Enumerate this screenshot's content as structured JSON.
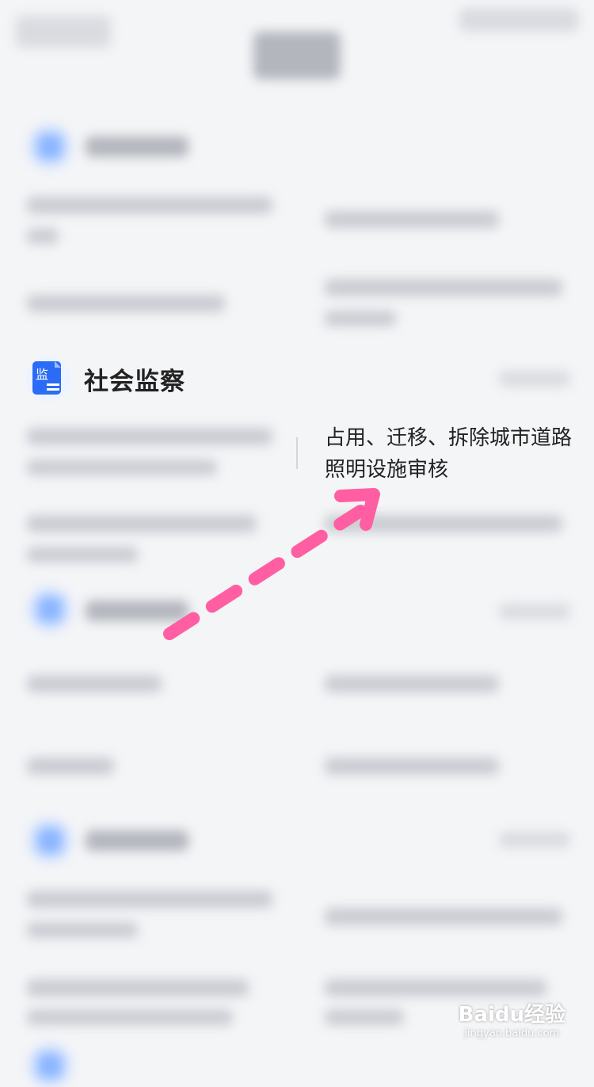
{
  "section": {
    "title": "社会监察",
    "icon": "monitor-doc-icon",
    "icon_glyph": "监"
  },
  "highlight_item": {
    "label": "占用、迁移、拆除城市道路照明设施审核"
  },
  "annotation": {
    "arrow": "dashed-arrow-icon",
    "color": "#ff5fa2"
  },
  "watermark": {
    "main": "Baidu经验",
    "sub": "jingyan.baidu.com"
  },
  "colors": {
    "accent": "#2b6cf6",
    "text": "#222222"
  }
}
